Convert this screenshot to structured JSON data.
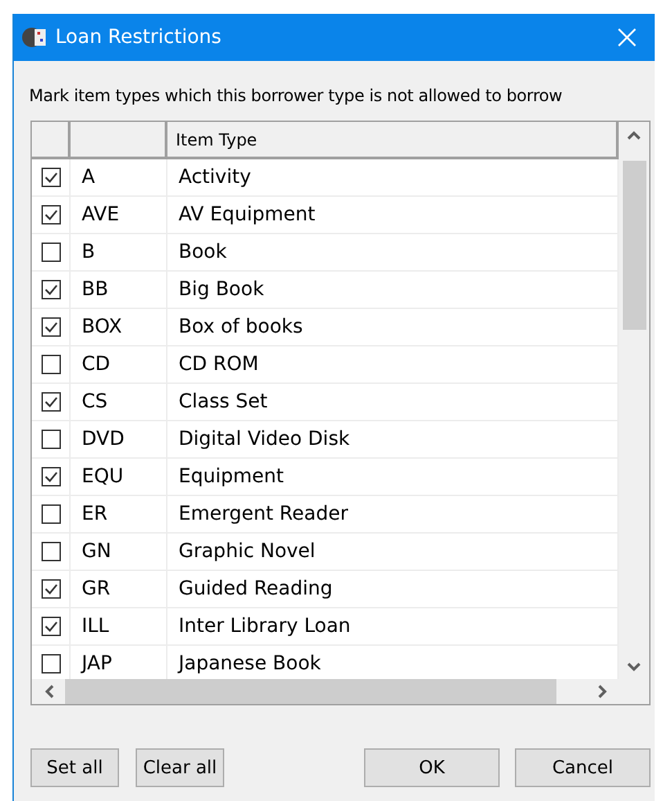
{
  "window": {
    "title": "Loan Restrictions"
  },
  "instruction": "Mark item types which this borrower type is not allowed to borrow",
  "table": {
    "columns": [
      "Item Type"
    ],
    "rows": [
      {
        "code": "A",
        "name": "Activity",
        "checked": true
      },
      {
        "code": "AVE",
        "name": "AV Equipment",
        "checked": true
      },
      {
        "code": "B",
        "name": "Book",
        "checked": false
      },
      {
        "code": "BB",
        "name": "Big Book",
        "checked": true
      },
      {
        "code": "BOX",
        "name": "Box of books",
        "checked": true
      },
      {
        "code": "CD",
        "name": "CD ROM",
        "checked": false
      },
      {
        "code": "CS",
        "name": "Class Set",
        "checked": true
      },
      {
        "code": "DVD",
        "name": "Digital Video Disk",
        "checked": false
      },
      {
        "code": "EQU",
        "name": "Equipment",
        "checked": true
      },
      {
        "code": "ER",
        "name": "Emergent Reader",
        "checked": false
      },
      {
        "code": "GN",
        "name": "Graphic Novel",
        "checked": false
      },
      {
        "code": "GR",
        "name": "Guided Reading",
        "checked": true
      },
      {
        "code": "ILL",
        "name": "Inter Library Loan",
        "checked": true
      },
      {
        "code": "JAP",
        "name": "Japanese Book",
        "checked": false
      }
    ]
  },
  "buttons_left": [
    "Set all",
    "Clear all"
  ],
  "buttons_right": [
    "OK",
    "Cancel"
  ]
}
